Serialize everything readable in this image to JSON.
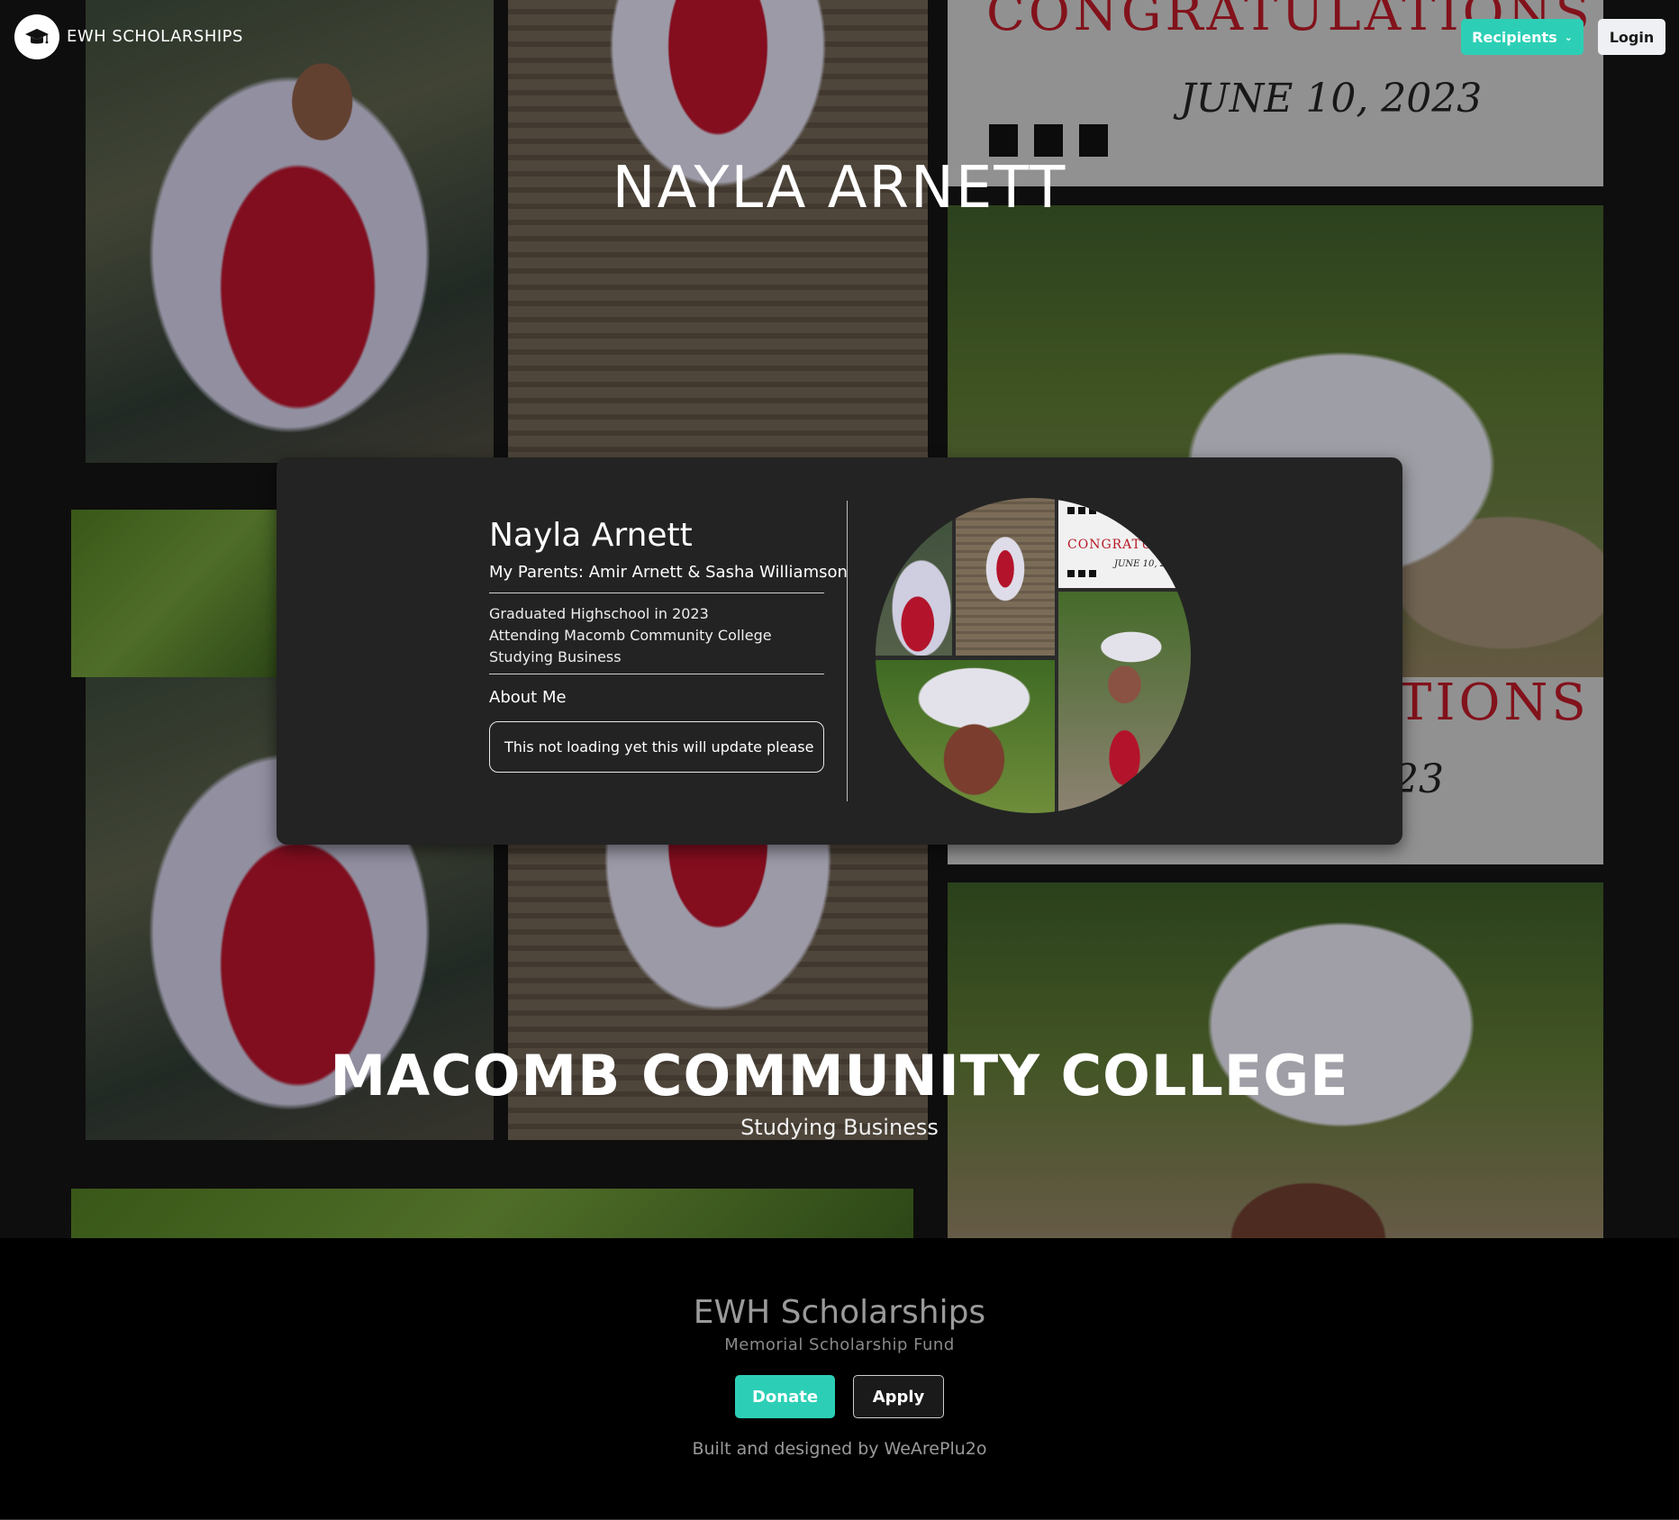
{
  "nav": {
    "brand": "EWH SCHOLARSHIPS",
    "recipients_label": "Recipients",
    "login_label": "Login",
    "logo_icon": "graduation-cap-icon",
    "accent": "#2ccfb5"
  },
  "hero": {
    "name_heading": "NAYLA ARNETT",
    "school_heading": "MACOMB COMMUNITY COLLEGE",
    "school_subheading": "Studying Business",
    "banner_text": "CONGRATULATIONS",
    "banner_date": "JUNE 10, 2023",
    "banner_text_partial": "TIONS",
    "banner_date_partial": "23"
  },
  "profile": {
    "name": "Nayla Arnett",
    "parents": "My Parents: Amir Arnett & Sasha Williamson",
    "facts": [
      "Graduated Highschool in 2023",
      "Attending Macomb Community College",
      "Studying Business"
    ],
    "about_heading": "About Me",
    "about_text": "This not loading yet this will update please",
    "collage_banner_text": "CONGRATULA",
    "collage_banner_name": "Na",
    "collage_banner_date": "JUNE 10, 202"
  },
  "footer": {
    "title": "EWH Scholarships",
    "subtitle": "Memorial Scholarship Fund",
    "donate_label": "Donate",
    "apply_label": "Apply",
    "credit": "Built and designed by WeArePlu2o"
  }
}
